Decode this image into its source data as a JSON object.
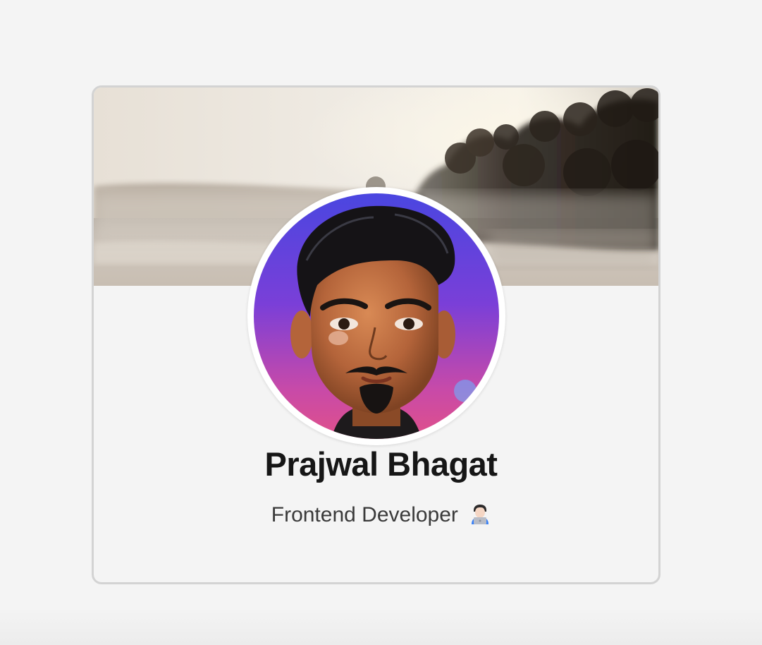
{
  "profile": {
    "name": "Prajwal Bhagat",
    "role": "Frontend Developer",
    "role_emoji": "man-technologist-icon"
  },
  "colors": {
    "page_background": "#f4f4f4",
    "card_border": "#d3d3d3",
    "name_text": "#161616",
    "role_text": "#3a3a3a",
    "avatar_gradient_top": "#4a46e0",
    "avatar_gradient_bottom": "#e0508a"
  }
}
